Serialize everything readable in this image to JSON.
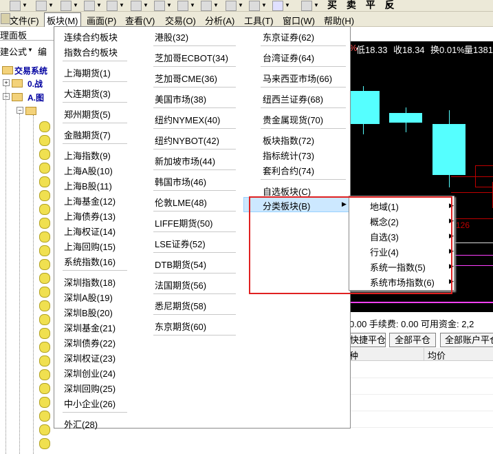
{
  "toolbar": {
    "right_text": "买 卖 平 反"
  },
  "menubar": {
    "items": [
      {
        "label": "文件(F)"
      },
      {
        "label": "板块(M)"
      },
      {
        "label": "画面(P)"
      },
      {
        "label": "查看(V)"
      },
      {
        "label": "交易(O)"
      },
      {
        "label": "分析(A)"
      },
      {
        "label": "工具(T)"
      },
      {
        "label": "窗口(W)"
      },
      {
        "label": "帮助(H)"
      }
    ]
  },
  "left_panel": {
    "title": "理面板",
    "subtitle": "建公式",
    "sub_dropdown": "编",
    "tree": [
      {
        "label": "交易系统"
      },
      {
        "label": "0.战"
      },
      {
        "label": "A.图"
      }
    ]
  },
  "quote_bar": {
    "low": "低18.33",
    "close": "收18.34",
    "turnover": "换0.01%",
    "volume": "量1381"
  },
  "board_menu": {
    "col1": [
      "连续合约板块",
      "指数合约板块",
      "上海期货(1)",
      "大连期货(3)",
      "郑州期货(5)",
      "金融期货(7)",
      "上海指数(9)",
      "上海A股(10)",
      "上海B股(11)",
      "上海基金(12)",
      "上海债券(13)",
      "上海权证(14)",
      "上海回购(15)",
      "系统指数(16)",
      "深圳指数(18)",
      "深圳A股(19)",
      "深圳B股(20)",
      "深圳基金(21)",
      "深圳债券(22)",
      "深圳权证(23)",
      "深圳创业(24)",
      "深圳回购(25)",
      "中小企业(26)",
      "外汇(28)"
    ],
    "col2": [
      "港股(32)",
      "芝加哥ECBOT(34)",
      "芝加哥CME(36)",
      "美国市场(38)",
      "纽约NYMEX(40)",
      "纽约NYBOT(42)",
      "新加坡市场(44)",
      "韩国市场(46)",
      "伦敦LME(48)",
      "LIFFE期货(50)",
      "LSE证券(52)",
      "DTB期货(54)",
      "法国期货(56)",
      "悉尼期货(58)",
      "东京期货(60)"
    ],
    "col3": [
      "东京证券(62)",
      "台湾证券(64)",
      "马来西亚市场(66)",
      "纽西兰证券(68)",
      "贵金属现货(70)",
      "板块指数(72)",
      "指标统计(73)",
      "套利合约(74)",
      "自选板块(C)",
      "分类板块(B)"
    ]
  },
  "submenu": {
    "items": [
      "地域(1)",
      "概念(2)",
      "自选(3)",
      "行业(4)",
      "系统一指数(5)",
      "系统市场指数(6)"
    ]
  },
  "chart": {
    "price_label": "126"
  },
  "trade": {
    "info": "0.00  手续费: 0.00  可用资金: 2,2",
    "quick_close": "快捷平仓",
    "close_all": "全部平仓",
    "close_all_accounts": "全部账户平仓",
    "col_type": "种",
    "col_avg_price": "均价"
  },
  "colors": {
    "highlight": "#cce8ff",
    "candle": "#55ffff",
    "annotation": "#e02020",
    "chart_bg": "#000000"
  }
}
